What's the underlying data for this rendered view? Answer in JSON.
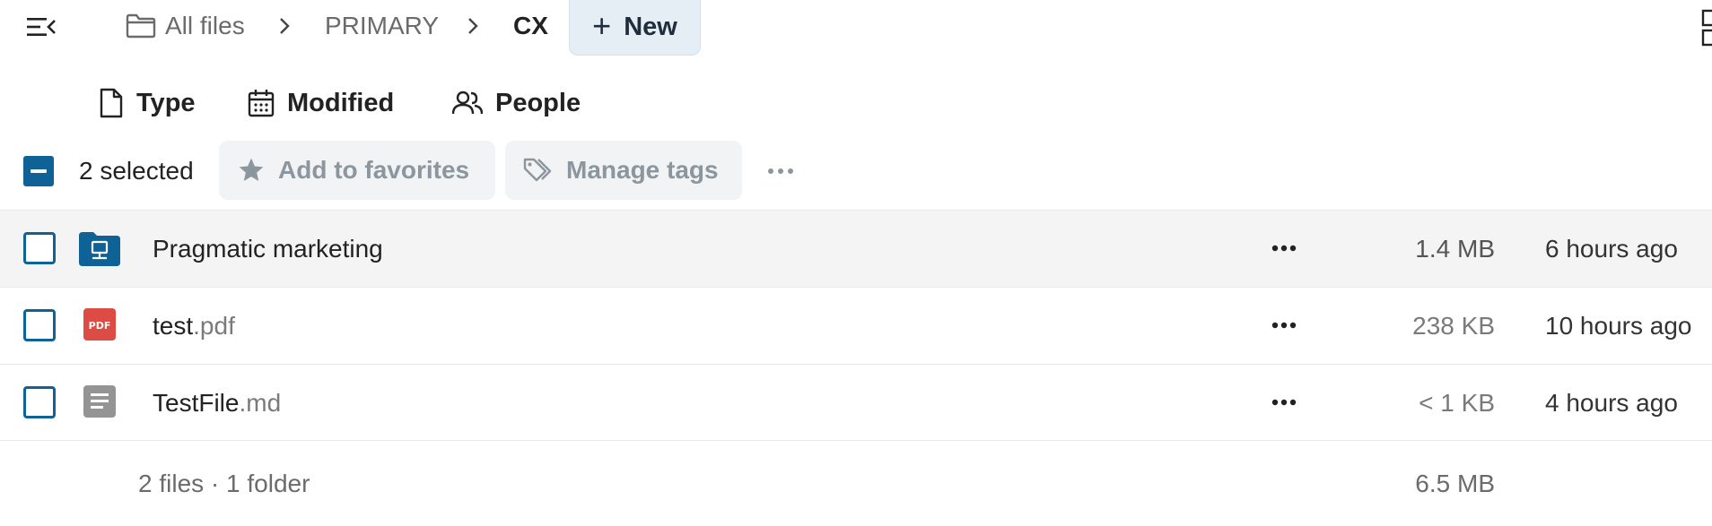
{
  "header": {
    "breadcrumbs": [
      {
        "label": "All files",
        "icon": "folder-icon"
      },
      {
        "label": "PRIMARY"
      },
      {
        "label": "CX"
      }
    ],
    "new_button_label": "New"
  },
  "filters": [
    {
      "label": "Type",
      "icon": "file-icon"
    },
    {
      "label": "Modified",
      "icon": "calendar-icon"
    },
    {
      "label": "People",
      "icon": "people-icon"
    }
  ],
  "selection": {
    "count_label": "2 selected",
    "actions": [
      {
        "label": "Add to favorites",
        "icon": "star-icon"
      },
      {
        "label": "Manage tags",
        "icon": "tag-icon"
      }
    ]
  },
  "files": [
    {
      "name": "Pragmatic marketing",
      "ext": "",
      "icon": "shared-folder-icon",
      "size": "1.4 MB",
      "modified": "6 hours ago",
      "highlighted": true
    },
    {
      "name": "test",
      "ext": ".pdf",
      "icon": "pdf-icon",
      "pdf_badge": "PDF",
      "size": "238 KB",
      "modified": "10 hours ago",
      "highlighted": false
    },
    {
      "name": "TestFile",
      "ext": ".md",
      "icon": "text-document-icon",
      "size": "< 1 KB",
      "modified": "4 hours ago",
      "highlighted": false
    }
  ],
  "summary": {
    "counts": "2 files · 1 folder",
    "total_size": "6.5 MB"
  },
  "colors": {
    "accent": "#0f6296",
    "pdf": "#dd4b45",
    "doc_icon": "#949494",
    "new_button_bg": "#e6eef5"
  }
}
